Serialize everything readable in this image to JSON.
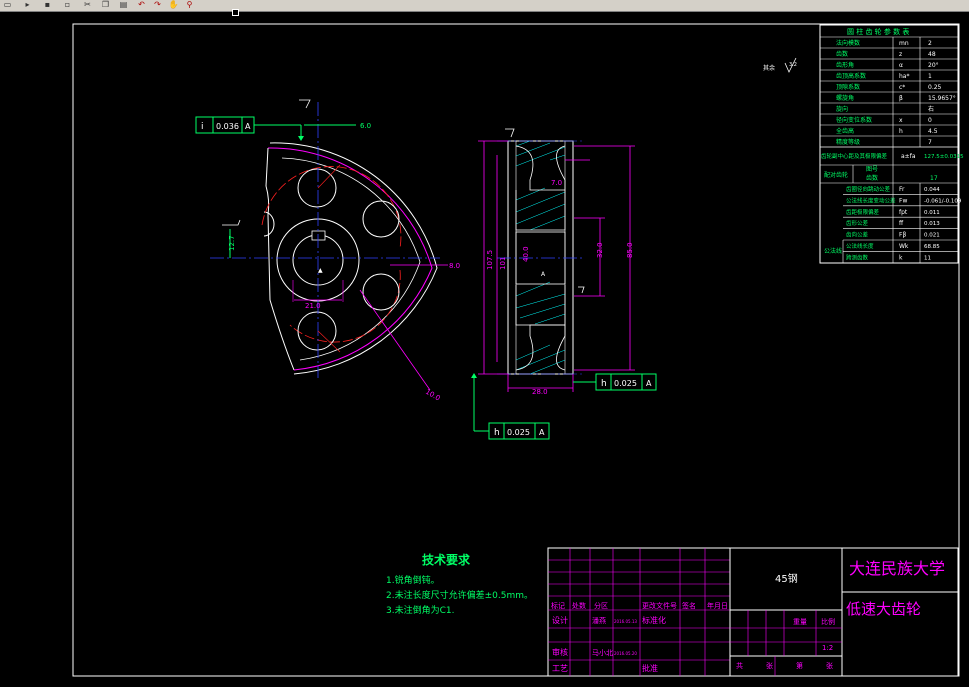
{
  "toolbar": {
    "icons": [
      "new-file-icon",
      "open-icon",
      "save-icon",
      "print-icon",
      "cut-icon",
      "copy-icon",
      "paste-icon",
      "undo-icon",
      "redo-icon",
      "pan-icon",
      "zoom-icon"
    ]
  },
  "colors": {
    "background": "#000000",
    "frame": "#ffffff",
    "green": "#00ff66",
    "magenta": "#ff00ff",
    "red": "#ff2020",
    "blue": "#3040ff",
    "cyan": "#00ffff",
    "yellow": "#ffff00"
  },
  "roughness_mark": "3.2",
  "tolerance_frames": {
    "radial_runout": {
      "symbol": "i",
      "value": "0.036",
      "datum": "A"
    },
    "face_runout_1": {
      "symbol": "h",
      "value": "0.025",
      "datum": "A"
    },
    "face_runout_2": {
      "symbol": "h",
      "value": "0.025",
      "datum": "A"
    }
  },
  "dimensions": {
    "keyway_width": "6.0",
    "keyway_depth": "12.7",
    "hub_bore": "21.0",
    "hole_pattern": "8.0",
    "outer_radius": "10.0",
    "tip_diameter": "107.5",
    "root_diameter": "101",
    "hub_diameter": "40.0",
    "hole_diameter": "32.0",
    "rim_diameter": "85.0",
    "web_thickness": "7.0",
    "face_width": "28.0",
    "datum_label": "A"
  },
  "gear_params": {
    "title": "圆 柱 齿 轮 参 数 表",
    "rows": [
      {
        "name": "法向模数",
        "symbol": "mn",
        "value": "2"
      },
      {
        "name": "齿数",
        "symbol": "z",
        "value": "48"
      },
      {
        "name": "齿形角",
        "symbol": "α",
        "value": "20°"
      },
      {
        "name": "齿顶高系数",
        "symbol": "ha*",
        "value": "1"
      },
      {
        "name": "顶隙系数",
        "symbol": "c*",
        "value": "0.25"
      },
      {
        "name": "螺旋角",
        "symbol": "β",
        "value": "15.9657°"
      },
      {
        "name": "旋向",
        "symbol": "",
        "value": "右"
      },
      {
        "name": "径向变位系数",
        "symbol": "x",
        "value": "0"
      },
      {
        "name": "全齿高",
        "symbol": "h",
        "value": "4.5"
      },
      {
        "name": "精度等级",
        "symbol": "",
        "value": "7"
      }
    ],
    "mate_row": {
      "name": "齿轮副中心距及其极限偏差",
      "symbol": "a±fa",
      "value": "127.5±0.0315"
    },
    "mate_gear": {
      "name": "配对齿轮",
      "label1": "图号",
      "label2": "齿数",
      "value": "17"
    },
    "check_rows": [
      {
        "name": "齿圈径向跳动公差",
        "symbol": "Fr",
        "value": "0.044"
      },
      {
        "name": "公法线长度变动公差",
        "symbol": "Fw",
        "value": "-0.061/-0.109"
      },
      {
        "name": "齿距极限偏差",
        "symbol": "fpt",
        "value": "0.011"
      },
      {
        "name": "齿形公差",
        "symbol": "ff",
        "value": "0.013"
      },
      {
        "name": "齿向公差",
        "symbol": "Fβ",
        "value": "0.021"
      },
      {
        "name": "公法线长度",
        "symbol": "Wk",
        "value": "68.85"
      },
      {
        "name": "跨测齿数",
        "symbol": "k",
        "value": "11"
      }
    ],
    "group_label": "公法线"
  },
  "tech_requirements": {
    "title": "技术要求",
    "items": [
      "1.锐角倒钝。",
      "2.未注长度尺寸允许偏差±0.5mm。",
      "3.未注倒角为C1."
    ]
  },
  "title_block": {
    "material": "45钢",
    "university": "大连民族大学",
    "part_name": "低速大齿轮",
    "headers": [
      "标记",
      "处数",
      "分区",
      "更改文件号",
      "签名",
      "年月日"
    ],
    "design_label": "设计",
    "designer": "潘燕",
    "design_date": "2016.05.13",
    "standardize_label": "标准化",
    "review_label": "审核",
    "reviewer": "马小北",
    "review_date": "2016.05.20",
    "process_label": "工艺",
    "approve_label": "批准",
    "weight_label": "重量",
    "scale_label": "比例",
    "scale_value": "1:2",
    "sheet_total_label": "共",
    "sheet_label": "张",
    "sheet_no_label": "第",
    "sheet_label2": "张"
  }
}
